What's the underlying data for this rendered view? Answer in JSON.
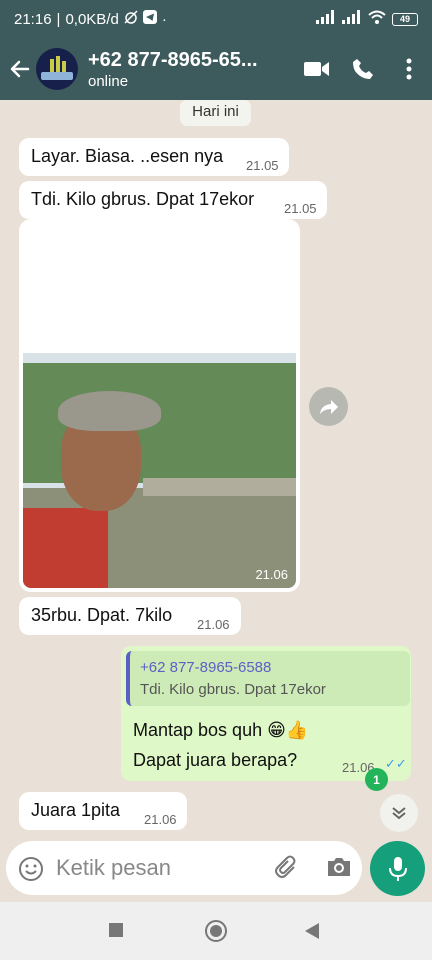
{
  "statusbar": {
    "time": "21:16",
    "data_rate": "0,0KB/d",
    "battery": "49"
  },
  "header": {
    "contact_name": "+62 877-8965-65...",
    "status": "online"
  },
  "chat": {
    "date_chip": "Hari ini",
    "messages": [
      {
        "text": "Layar. Biasa. ..esen nya",
        "time": "21.05"
      },
      {
        "text": "Tdi. Kilo gbrus. Dpat 17ekor",
        "time": "21.05"
      },
      {
        "photo_time": "21.06"
      },
      {
        "text": "35rbu. Dpat. 7kilo",
        "time": "21.06"
      },
      {
        "reply_to_name": "+62 877-8965-6588",
        "reply_to_text": "Tdi. Kilo gbrus. Dpat 17ekor",
        "line1": "Mantap bos quh 😁👍",
        "line2": "Dapat juara berapa?",
        "time": "21.06"
      },
      {
        "text": "Juara 1pita",
        "time": "21.06"
      }
    ],
    "unread_count": "1"
  },
  "composer": {
    "placeholder": "Ketik pesan"
  },
  "icons": {
    "back": "arrow-left-icon",
    "video": "video-camera-icon",
    "call": "phone-icon",
    "more": "more-vertical-icon",
    "emoji": "emoji-icon",
    "attach": "paperclip-icon",
    "camera": "camera-icon",
    "mic": "microphone-icon"
  },
  "colors": {
    "appbar": "#3d5a5c",
    "outgoing_bubble": "#dff8c7",
    "incoming_bubble": "#ffffff",
    "accent": "#159f7a",
    "read_ticks": "#3aa0e4"
  }
}
